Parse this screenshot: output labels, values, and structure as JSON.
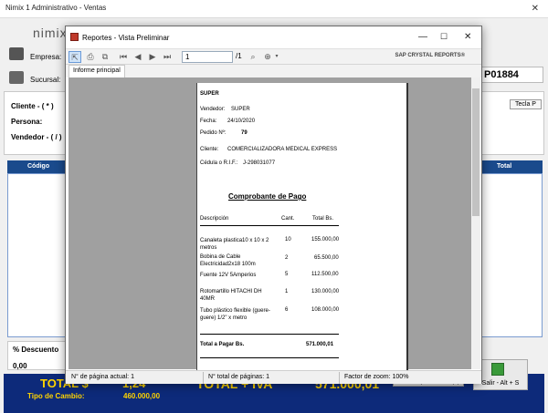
{
  "app": {
    "title": "Nimix 1 Administrativo - Ventas",
    "logo": "nimix",
    "labels": {
      "empresa": "Empresa:",
      "sucursal": "Sucursal:",
      "cliente": "Cliente - ( * )",
      "persona": "Persona:",
      "vendedor": "Vendedor - ( / )",
      "descuento": "% Descuento",
      "descuento_value": "0,00",
      "grid_codigo": "Código",
      "grid_total": "Total",
      "tecla_p": "Tecla P",
      "invoice_number": "P01884",
      "salir": "Salir - Alt + S",
      "panel_opciones": "Panel de Opciones - Tecla (G)"
    },
    "totals": {
      "total_usd_label": "TOTAL $",
      "total_usd_value": "1,24",
      "tipo_cambio_label": "Tipo de Cambio:",
      "tipo_cambio_value": "460.000,00",
      "total_iva_label": "TOTAL + IVA",
      "total_iva_value": "571.000,01"
    }
  },
  "reports_window": {
    "title": "Reportes - Vista Preliminar",
    "page_input": "1",
    "page_total": "/1",
    "sap_brand": "SAP CRYSTAL REPORTS®",
    "tab_main": "Informe principal",
    "status": {
      "current_page": "N° de página actual: 1",
      "total_pages": "N° total de páginas: 1",
      "zoom": "Factor de zoom: 100%"
    }
  },
  "report": {
    "company": "SUPER",
    "vendedor_label": "Vendedor:",
    "vendedor_value": "SUPER",
    "fecha_label": "Fecha:",
    "fecha_value": "24/10/2020",
    "pedido_label": "Pedido Nº:",
    "pedido_value": "79",
    "cliente_label": "Cliente:",
    "cliente_value": "COMERCIALIZADORA MEDICAL EXPRESS",
    "cedula_label": "Cédula o R.I.F.:",
    "cedula_value": "J-298031077",
    "title": "Comprobante de Pago",
    "col_desc": "Descripción",
    "col_cant": "Cant.",
    "col_total": "Total Bs.",
    "items": [
      {
        "desc": "Canaleta plastica10 x 10 x 2 metros",
        "cant": "10",
        "total": "155.000,00"
      },
      {
        "desc": "Bobina de Cable Electricidad2x18 100m",
        "cant": "2",
        "total": "65.500,00"
      },
      {
        "desc": "Fuente 12V 5Amperios",
        "cant": "5",
        "total": "112.500,00"
      },
      {
        "desc": "Rotomartillo HITACHI DH 40MR",
        "cant": "1",
        "total": "130.000,00"
      },
      {
        "desc": "Tubo plástico flexible (guere-guere) 1/2\" x metro",
        "cant": "6",
        "total": "108.000,00"
      }
    ],
    "total_label": "Total a Pagar Bs.",
    "total_value": "571.000,01"
  }
}
